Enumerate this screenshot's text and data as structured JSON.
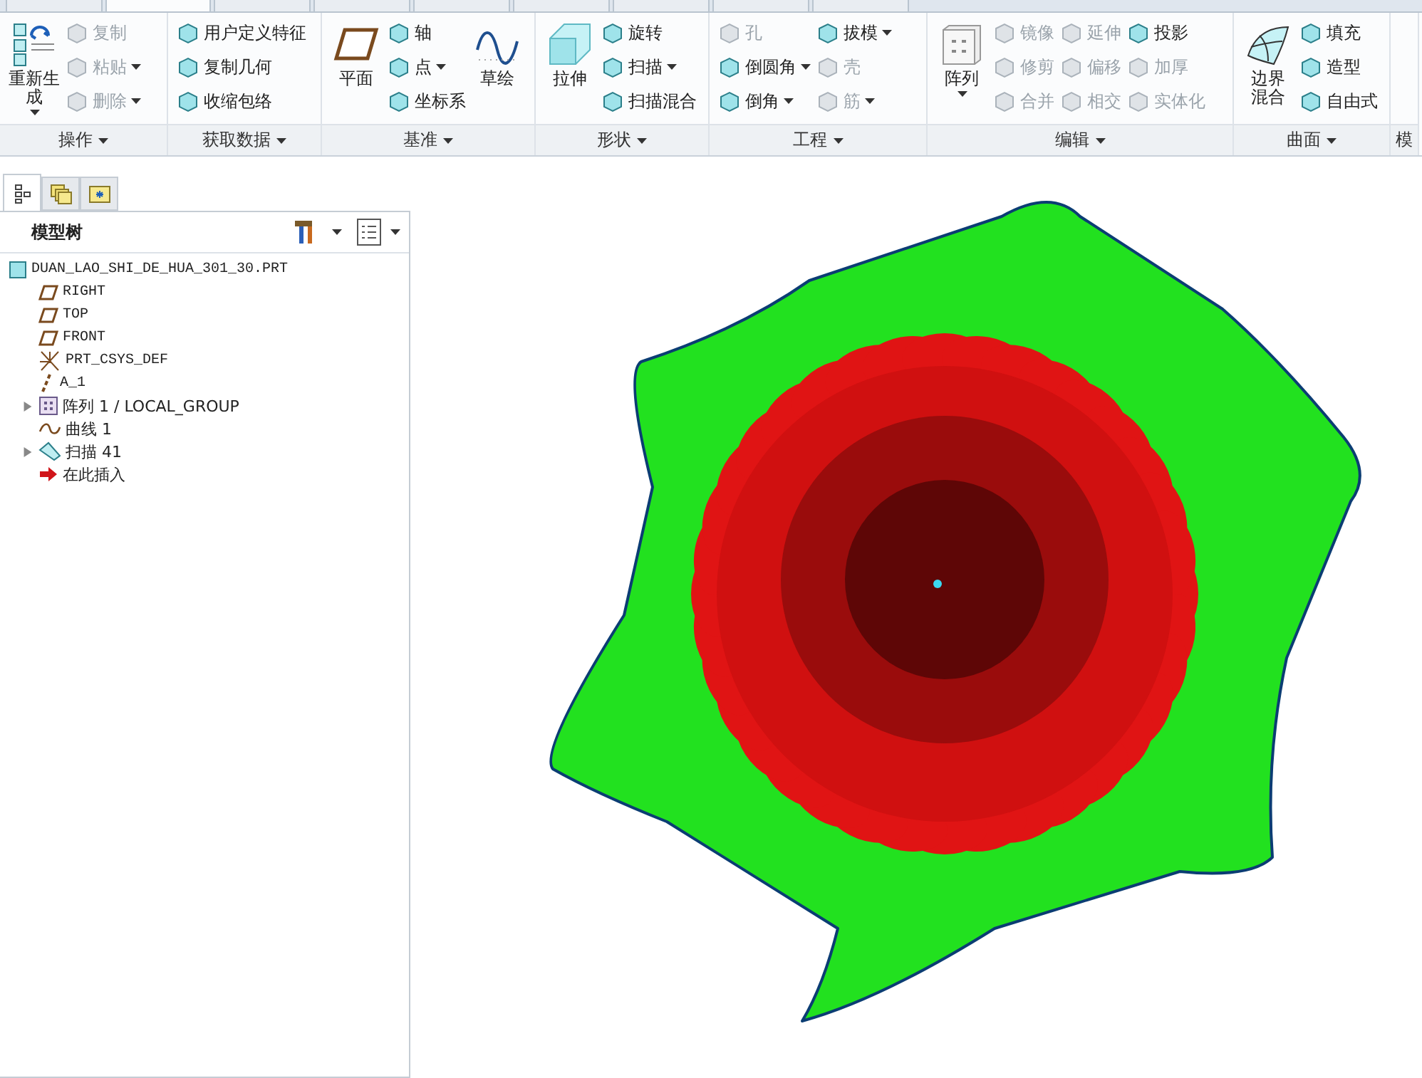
{
  "menu_tabs": [
    {
      "selected": false
    },
    {
      "selected": true
    },
    {
      "selected": false
    },
    {
      "selected": false
    },
    {
      "selected": false
    },
    {
      "selected": false
    },
    {
      "selected": false
    },
    {
      "selected": false
    },
    {
      "selected": false
    }
  ],
  "ribbon": {
    "groups": [
      {
        "label": "操作",
        "dropdown": true,
        "columns": [
          {
            "kind": "large",
            "label": "重新生成",
            "dropdown": true
          },
          {
            "kind": "stack",
            "items": [
              {
                "label": "复制",
                "disabled": true,
                "dropdown": false
              },
              {
                "label": "粘贴",
                "disabled": true,
                "dropdown": true
              },
              {
                "label": "删除",
                "disabled": true,
                "dropdown": true
              }
            ]
          }
        ]
      },
      {
        "label": "获取数据",
        "dropdown": true,
        "columns": [
          {
            "kind": "stack",
            "items": [
              {
                "label": "用户定义特征",
                "disabled": false,
                "dropdown": false
              },
              {
                "label": "复制几何",
                "disabled": false,
                "dropdown": false
              },
              {
                "label": "收缩包络",
                "disabled": false,
                "dropdown": false
              }
            ]
          }
        ]
      },
      {
        "label": "基准",
        "dropdown": true,
        "columns": [
          {
            "kind": "large",
            "label": "平面",
            "dropdown": false
          },
          {
            "kind": "stack",
            "items": [
              {
                "label": "轴",
                "disabled": false,
                "dropdown": false
              },
              {
                "label": "点",
                "disabled": false,
                "dropdown": true
              },
              {
                "label": "坐标系",
                "disabled": false,
                "dropdown": false
              }
            ]
          },
          {
            "kind": "large",
            "label": "草绘",
            "dropdown": false
          }
        ]
      },
      {
        "label": "形状",
        "dropdown": true,
        "columns": [
          {
            "kind": "large",
            "label": "拉伸",
            "dropdown": false
          },
          {
            "kind": "stack",
            "items": [
              {
                "label": "旋转",
                "disabled": false,
                "dropdown": false
              },
              {
                "label": "扫描",
                "disabled": false,
                "dropdown": true
              },
              {
                "label": "扫描混合",
                "disabled": false,
                "dropdown": false
              }
            ]
          }
        ]
      },
      {
        "label": "工程",
        "dropdown": true,
        "columns": [
          {
            "kind": "stack",
            "items": [
              {
                "label": "孔",
                "disabled": true,
                "dropdown": false
              },
              {
                "label": "倒圆角",
                "disabled": false,
                "dropdown": true
              },
              {
                "label": "倒角",
                "disabled": false,
                "dropdown": true
              }
            ]
          },
          {
            "kind": "stack",
            "items": [
              {
                "label": "拔模",
                "disabled": false,
                "dropdown": true
              },
              {
                "label": "壳",
                "disabled": true,
                "dropdown": false
              },
              {
                "label": "筋",
                "disabled": true,
                "dropdown": true
              }
            ]
          }
        ]
      },
      {
        "label": "编辑",
        "dropdown": true,
        "columns": [
          {
            "kind": "large",
            "label": "阵列",
            "dropdown": true
          },
          {
            "kind": "stack",
            "items": [
              {
                "label": "镜像",
                "disabled": true,
                "dropdown": false
              },
              {
                "label": "修剪",
                "disabled": true,
                "dropdown": false
              },
              {
                "label": "合并",
                "disabled": true,
                "dropdown": false
              }
            ]
          },
          {
            "kind": "stack",
            "items": [
              {
                "label": "延伸",
                "disabled": true,
                "dropdown": false
              },
              {
                "label": "偏移",
                "disabled": true,
                "dropdown": false
              },
              {
                "label": "相交",
                "disabled": true,
                "dropdown": false
              }
            ]
          },
          {
            "kind": "stack",
            "items": [
              {
                "label": "投影",
                "disabled": false,
                "dropdown": false
              },
              {
                "label": "加厚",
                "disabled": true,
                "dropdown": false
              },
              {
                "label": "实体化",
                "disabled": true,
                "dropdown": false
              }
            ]
          }
        ]
      },
      {
        "label": "曲面",
        "dropdown": true,
        "columns": [
          {
            "kind": "large",
            "label": "边界混合",
            "dropdown": false
          },
          {
            "kind": "stack",
            "items": [
              {
                "label": "填充",
                "disabled": false,
                "dropdown": false
              },
              {
                "label": "造型",
                "disabled": false,
                "dropdown": false
              },
              {
                "label": "自由式",
                "disabled": false,
                "dropdown": false
              }
            ]
          }
        ]
      },
      {
        "label": "模",
        "dropdown": false
      }
    ]
  },
  "panel_tabs": [
    {
      "selected": true
    },
    {
      "selected": false
    },
    {
      "selected": false
    }
  ],
  "model_tree": {
    "title": "模型树",
    "root": {
      "label": "DUAN_LAO_SHI_DE_HUA_301_30.PRT",
      "children": [
        {
          "kind": "plane",
          "label": "RIGHT"
        },
        {
          "kind": "plane",
          "label": "TOP"
        },
        {
          "kind": "plane",
          "label": "FRONT"
        },
        {
          "kind": "csys",
          "label": "PRT_CSYS_DEF"
        },
        {
          "kind": "axis",
          "label": "A_1"
        },
        {
          "kind": "pattern",
          "label": "阵列 1 / LOCAL_GROUP",
          "expanded": false
        },
        {
          "kind": "curve",
          "label": "曲线 1"
        },
        {
          "kind": "sweep",
          "label": "扫描 41",
          "expanded": false
        },
        {
          "kind": "insert",
          "label": "在此插入"
        }
      ]
    }
  }
}
